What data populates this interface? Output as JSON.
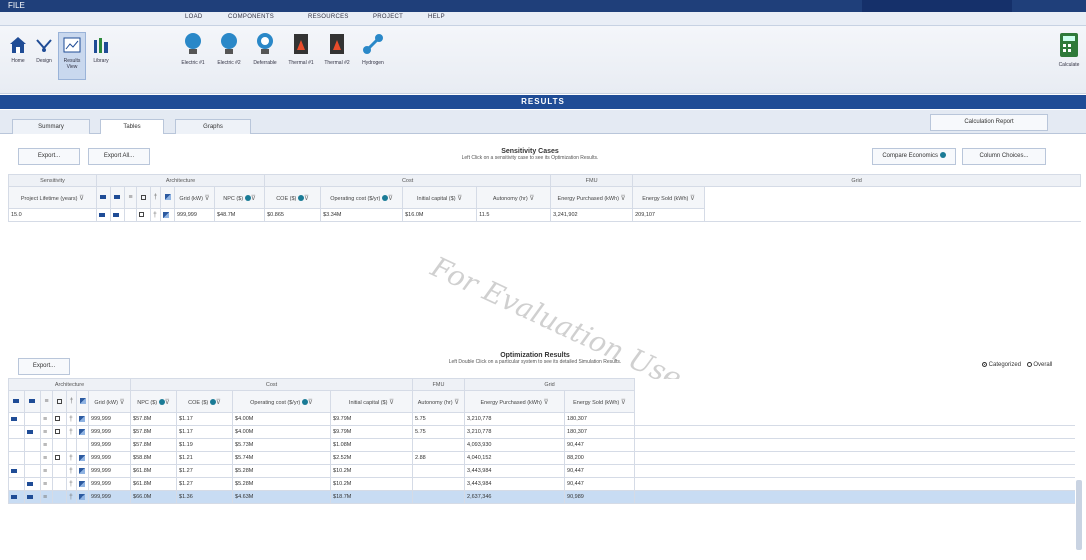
{
  "titlebar": {
    "app": "FILE"
  },
  "menu": [
    "FILE",
    "LOAD",
    "COMPONENTS",
    "RESOURCES",
    "PROJECT",
    "HELP"
  ],
  "ribbon": {
    "home": "Home",
    "design": "Design",
    "results": "Results",
    "view": "View",
    "library": "Library",
    "components": [
      "Electric #1",
      "Electric #2",
      "Deferrable",
      "Thermal #1",
      "Thermal #2",
      "Hydrogen"
    ],
    "calculate": "Calculate"
  },
  "banner": "RESULTS",
  "tabs": [
    "Summary",
    "Tables",
    "Graphs"
  ],
  "calc_report": "Calculation Report",
  "sens": {
    "export": "Export...",
    "export_all": "Export All...",
    "title": "Sensitivity Cases",
    "subtitle": "Left Click on a sensitivity case to see its Optimization Results.",
    "compare": "Compare Economics",
    "column_choices": "Column Choices...",
    "groups": [
      "Sensitivity",
      "Architecture",
      "Cost",
      "FMU",
      "Grid"
    ],
    "headers": [
      "Project Lifetime (years)",
      "Grid (kW)",
      "NPC ($)",
      "COE ($)",
      "Operating cost ($/yr)",
      "Initial capital ($)",
      "Autonomy (hr)",
      "Energy Purchased (kWh)",
      "Energy Sold (kWh)"
    ],
    "rows": [
      {
        "lifetime": "15.0",
        "grid": "999,999",
        "npc": "$48.7M",
        "coe": "$0.865",
        "opcost": "$3.34M",
        "capital": "$16.0M",
        "autonomy": "11.5",
        "purchased": "3,241,902",
        "sold": "209,107"
      }
    ]
  },
  "opt": {
    "export": "Export...",
    "title": "Optimization Results",
    "subtitle": "Left Double Click on a particular system to see its detailed Simulation Results.",
    "categorized": "Categorized",
    "overall": "Overall",
    "groups": [
      "Architecture",
      "Cost",
      "FMU",
      "Grid"
    ],
    "headers": [
      "Grid (kW)",
      "NPC ($)",
      "COE ($)",
      "Operating cost ($/yr)",
      "Initial capital ($)",
      "Autonomy (hr)",
      "Energy Purchased (kWh)",
      "Energy Sold (kWh)"
    ],
    "rows": [
      {
        "grid": "999,999",
        "npc": "$57.8M",
        "coe": "$1.17",
        "opcost": "$4.00M",
        "capital": "$9.79M",
        "autonomy": "5.75",
        "purchased": "3,210,778",
        "sold": "180,307"
      },
      {
        "grid": "999,999",
        "npc": "$57.8M",
        "coe": "$1.17",
        "opcost": "$4.00M",
        "capital": "$9.79M",
        "autonomy": "5.75",
        "purchased": "3,210,778",
        "sold": "180,307"
      },
      {
        "grid": "999,999",
        "npc": "$57.8M",
        "coe": "$1.19",
        "opcost": "$5.73M",
        "capital": "$1.08M",
        "autonomy": "",
        "purchased": "4,093,930",
        "sold": "90,447"
      },
      {
        "grid": "999,999",
        "npc": "$58.8M",
        "coe": "$1.21",
        "opcost": "$5.74M",
        "capital": "$2.52M",
        "autonomy": "2.88",
        "purchased": "4,040,152",
        "sold": "88,200"
      },
      {
        "grid": "999,999",
        "npc": "$61.8M",
        "coe": "$1.27",
        "opcost": "$5.28M",
        "capital": "$10.2M",
        "autonomy": "",
        "purchased": "3,443,984",
        "sold": "90,447"
      },
      {
        "grid": "999,999",
        "npc": "$61.8M",
        "coe": "$1.27",
        "opcost": "$5.28M",
        "capital": "$10.2M",
        "autonomy": "",
        "purchased": "3,443,984",
        "sold": "90,447"
      },
      {
        "grid": "999,999",
        "npc": "$66.0M",
        "coe": "$1.36",
        "opcost": "$4.63M",
        "capital": "$18.7M",
        "autonomy": "",
        "purchased": "2,637,346",
        "sold": "90,989"
      }
    ]
  },
  "watermark": "For Evaluation Use",
  "colors": {
    "banner": "#1f4c96",
    "titlebar": "#1f3f7a",
    "selected_row": "#c8dcf3",
    "icon_teal": "#1a7b96"
  }
}
